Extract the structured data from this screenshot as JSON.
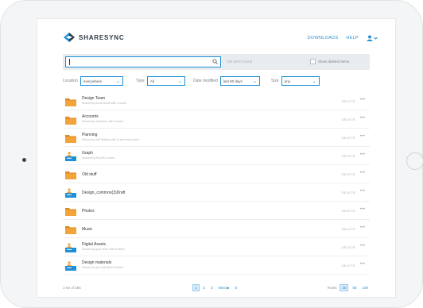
{
  "app": {
    "brand": "SHARESYNC",
    "nav": {
      "downloads": "DOWNLOADS",
      "help": "HELP"
    }
  },
  "search": {
    "placeholder": "",
    "found_text": "285 items found",
    "show_deleted_label": "Show deleted items"
  },
  "filters": {
    "location": {
      "label": "Location",
      "value": "everywhere"
    },
    "type": {
      "label": "Type",
      "value": "All"
    },
    "date": {
      "label": "Date modified",
      "value": "last 90 days"
    },
    "size": {
      "label": "Size",
      "value": "any"
    }
  },
  "rows": [
    {
      "name": "Design Team",
      "sub": "Shared by Anna Smith with 4 users",
      "kind": "folder",
      "delete": "DELETE"
    },
    {
      "name": "Accounts",
      "sub": "Shared by Jonathan with 5 users",
      "kind": "folder",
      "delete": "DELETE"
    },
    {
      "name": "Planning",
      "sub": "Shared by Jeff Walton with 2 users and a link",
      "kind": "folder",
      "delete": "DELETE"
    },
    {
      "name": "Graph",
      "sub": "Shared by Ali with 6 users",
      "kind": "shared",
      "delete": "DELETE"
    },
    {
      "name": "Old stuff",
      "sub": "",
      "kind": "folder",
      "delete": "DELETE"
    },
    {
      "name": "Design_common(3)Draft",
      "sub": "",
      "kind": "shared",
      "delete": "DELETE"
    },
    {
      "name": "Photos",
      "sub": "",
      "kind": "folder",
      "delete": "DELETE"
    },
    {
      "name": "Music",
      "sub": "",
      "kind": "folder",
      "delete": "DELETE"
    },
    {
      "name": "Digital Assets",
      "sub": "Shared by your team with 5 users",
      "kind": "shared",
      "delete": "DELETE"
    },
    {
      "name": "Design materials",
      "sub": "Shared by you with Brian Powell",
      "kind": "shared",
      "delete": "DELETE"
    }
  ],
  "footer": {
    "count": "1-50 of 285",
    "pages": [
      "1",
      "2",
      "3"
    ],
    "next_label": "Next",
    "last_page": "6",
    "rows_label": "Rows:",
    "rows_options": [
      "25",
      "50",
      "100"
    ]
  },
  "colors": {
    "accent": "#2a8fd6",
    "folder": "#f2a33a",
    "folder_dark": "#e08a1e",
    "shared_badge": "#1f8fd8"
  },
  "icons": {
    "search": "search-icon",
    "user": "user-icon",
    "chevron": "chevron-down-icon",
    "folder": "folder-icon",
    "shared_folder": "shared-folder-icon",
    "more": "more-dots-icon"
  }
}
